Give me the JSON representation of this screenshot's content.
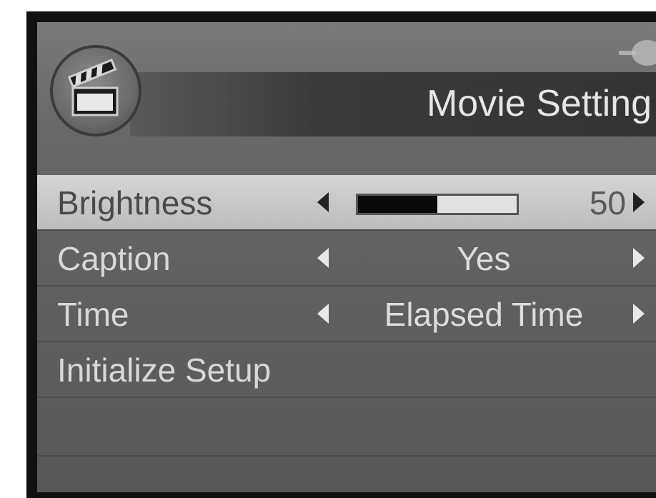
{
  "header": {
    "title": "Movie Setting",
    "icon": "clapperboard-icon"
  },
  "menu": {
    "brightness": {
      "label": "Brightness",
      "value": "50",
      "level_fraction": 0.5
    },
    "caption": {
      "label": "Caption",
      "value": "Yes"
    },
    "time": {
      "label": "Time",
      "value": "Elapsed Time"
    },
    "initialize": {
      "label": "Initialize Setup"
    }
  },
  "colors": {
    "panel": "#686868",
    "header_bar": "#363636",
    "selected_row": "#c8c8c8",
    "text": "#d8d8d8"
  }
}
